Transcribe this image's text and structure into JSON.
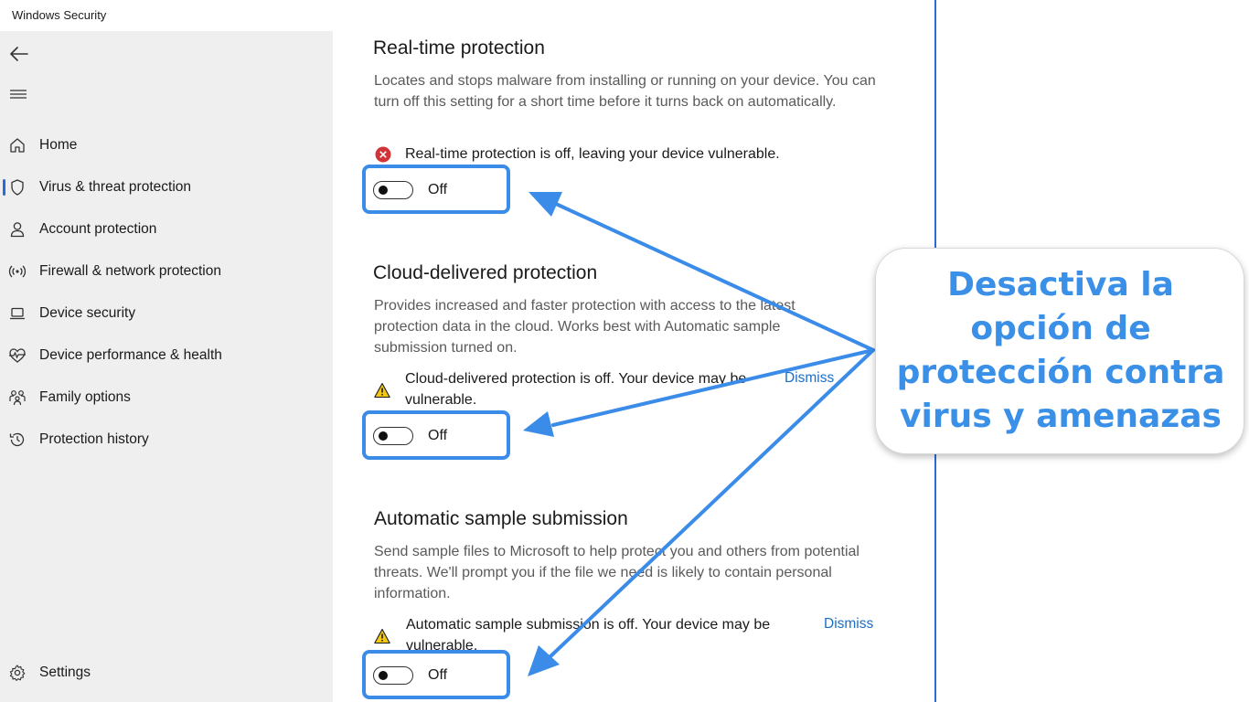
{
  "window": {
    "title": "Windows Security"
  },
  "sidebar": {
    "items": [
      {
        "id": "home",
        "label": "Home",
        "icon": "home-icon"
      },
      {
        "id": "virus",
        "label": "Virus & threat protection",
        "icon": "shield-icon",
        "active": true
      },
      {
        "id": "account",
        "label": "Account protection",
        "icon": "person-icon"
      },
      {
        "id": "firewall",
        "label": "Firewall & network protection",
        "icon": "wifi-antenna-icon"
      },
      {
        "id": "device-security",
        "label": "Device security",
        "icon": "laptop-icon"
      },
      {
        "id": "performance",
        "label": "Device performance & health",
        "icon": "heart-pulse-icon"
      },
      {
        "id": "family",
        "label": "Family options",
        "icon": "family-icon"
      },
      {
        "id": "history",
        "label": "Protection history",
        "icon": "history-icon"
      }
    ],
    "settings_label": "Settings"
  },
  "sections": {
    "realtime": {
      "title": "Real-time protection",
      "description": "Locates and stops malware from installing or running on your device. You can turn off this setting for a short time before it turns back on automatically.",
      "status": "Real-time protection is off, leaving your device vulnerable.",
      "status_icon": "error-icon",
      "toggle_label": "Off"
    },
    "cloud": {
      "title": "Cloud-delivered protection",
      "description": "Provides increased and faster protection with access to the latest protection data in the cloud. Works best with Automatic sample submission turned on.",
      "status": "Cloud-delivered protection is off. Your device may be vulnerable.",
      "status_icon": "warning-icon",
      "dismiss": "Dismiss",
      "toggle_label": "Off"
    },
    "sample": {
      "title": "Automatic sample submission",
      "description": "Send sample files to Microsoft to help protect you and others from potential threats. We'll prompt you if the file we need is likely to contain personal information.",
      "status": "Automatic sample submission is off. Your device may be vulnerable.",
      "status_icon": "warning-icon",
      "dismiss": "Dismiss",
      "toggle_label": "Off"
    }
  },
  "callout": {
    "text": "Desactiva la opción de protección contra virus y amenazas"
  },
  "colors": {
    "accent": "#2b6bd6",
    "annotation": "#3b8ce8",
    "link": "#1a6fc7",
    "error": "#d13438",
    "warning": "#f2c811"
  }
}
